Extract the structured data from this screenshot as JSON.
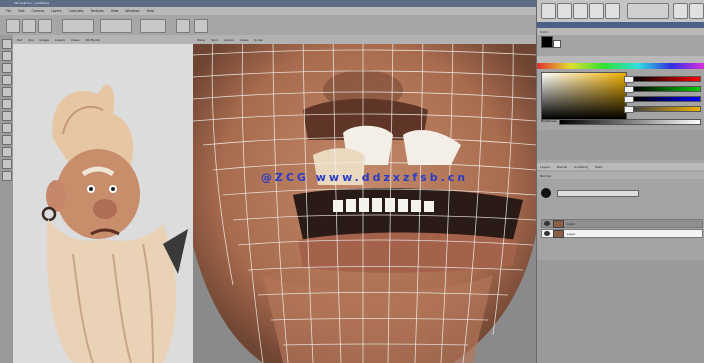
{
  "window": {
    "title": "3D-Coat 4.x - (untitled)"
  },
  "menu": [
    "File",
    "Edit",
    "Camera",
    "Layers",
    "Calculate",
    "Textures",
    "View",
    "Windows",
    "Help"
  ],
  "viewport_header": [
    "Plane",
    "Spin",
    "Layers",
    "Views",
    "Scale"
  ],
  "reference_header": [
    "Ref",
    "Ups",
    "Image",
    "Layers",
    "Views",
    "3D Model"
  ],
  "watermark": "@ZCG www.ddzxzfsb.cn",
  "color_panel": {
    "title": "Color",
    "brightness_label": "Brightness",
    "primary_color": "#c8902e",
    "values": [
      "0",
      "0",
      "0",
      "0"
    ]
  },
  "layers_panel": {
    "tabs": [
      "Layers",
      "Blends",
      "Sculpting",
      "Paint"
    ],
    "mode": "Normal",
    "items": [
      "Color",
      "Layer"
    ]
  },
  "colors": {
    "skin": "#b07454",
    "wire": "#f2f0ea",
    "panel": "#a4a4a4",
    "accent": "#4c5f86"
  },
  "icons": {
    "zoom": "zoom-icon",
    "rotate": "rotate-icon",
    "brush": "brush-icon",
    "eye": "eye-icon"
  }
}
